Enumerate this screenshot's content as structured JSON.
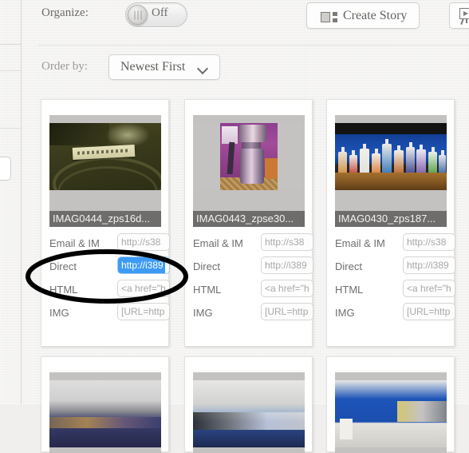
{
  "toolbar": {
    "organize_label": "Organize:",
    "organize_state": "Off",
    "create_story_label": "Create Story",
    "create_story_icon": "collage-icon",
    "slideshow_icon": "easel-play-icon"
  },
  "orderby": {
    "label": "Order by:",
    "selected": "Newest First",
    "chevron_icon": "chevron-down-icon"
  },
  "field_labels": {
    "email": "Email & IM",
    "direct": "Direct",
    "html": "HTML",
    "img": "IMG"
  },
  "colors": {
    "selection_blue": "#3d9bf5",
    "caption_grey": "#6e6d6b",
    "page_bg": "#f2f1f0",
    "annotation": "#000000"
  },
  "cards": [
    {
      "caption": "IMAG0444_zps16d...",
      "fields": {
        "email": "http://s38",
        "direct": "http://i389",
        "html": "<a href=\"h",
        "img": "[URL=http"
      },
      "direct_selected": true
    },
    {
      "caption": "IMAG0443_zpse30...",
      "fields": {
        "email": "http://s38",
        "direct": "http://i389",
        "html": "<a href=\"h",
        "img": "[URL=http"
      },
      "direct_selected": false
    },
    {
      "caption": "IMAG0430_zps187...",
      "fields": {
        "email": "http://s38",
        "direct": "http://i389",
        "html": "<a href=\"h",
        "img": "[URL=http"
      },
      "direct_selected": false
    }
  ],
  "annotation": {
    "shape": "ellipse",
    "target": "direct-link-field-card-1"
  }
}
